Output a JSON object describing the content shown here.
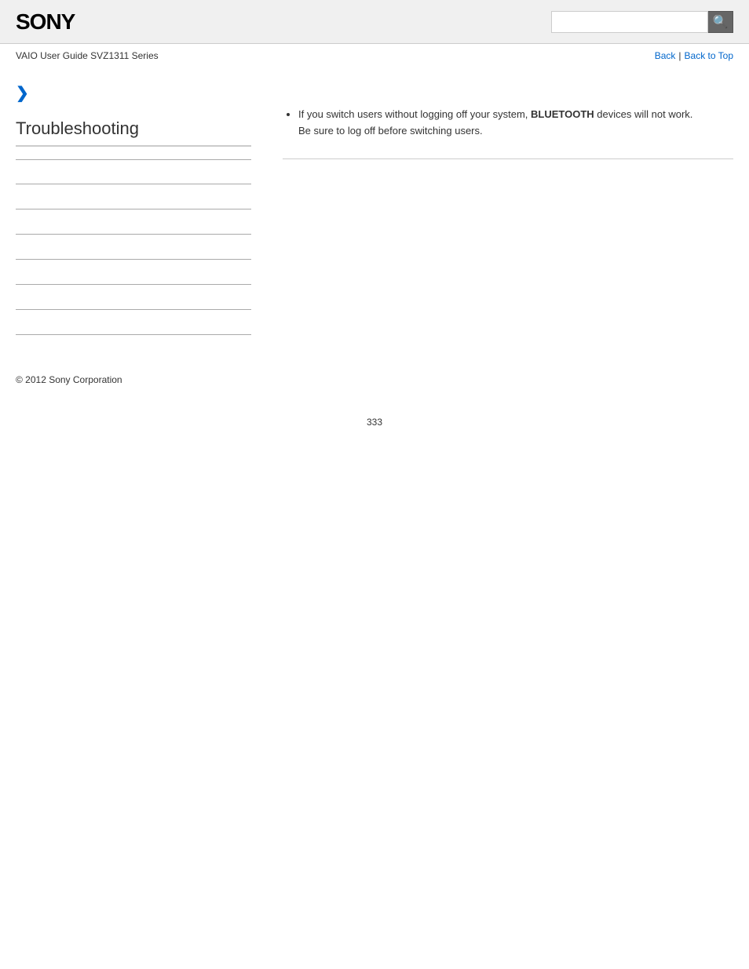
{
  "header": {
    "logo": "SONY",
    "search_placeholder": "",
    "search_icon_label": "🔍"
  },
  "nav": {
    "guide_title": "VAIO User Guide SVZ1311 Series",
    "back_label": "Back",
    "separator": "|",
    "back_to_top_label": "Back to Top"
  },
  "sidebar": {
    "chevron": "❯",
    "title": "Troubleshooting",
    "links": [
      {
        "label": ""
      },
      {
        "label": ""
      },
      {
        "label": ""
      },
      {
        "label": ""
      },
      {
        "label": ""
      },
      {
        "label": ""
      },
      {
        "label": ""
      }
    ]
  },
  "content": {
    "note_text_1": "If you switch users without logging off your system, BLUETOOTH devices will not work.",
    "note_text_2": "Be sure to log off before switching users.",
    "bluetooth_emphasis": "BLUETOOTH"
  },
  "footer": {
    "copyright": "© 2012 Sony Corporation"
  },
  "page_number": "333"
}
